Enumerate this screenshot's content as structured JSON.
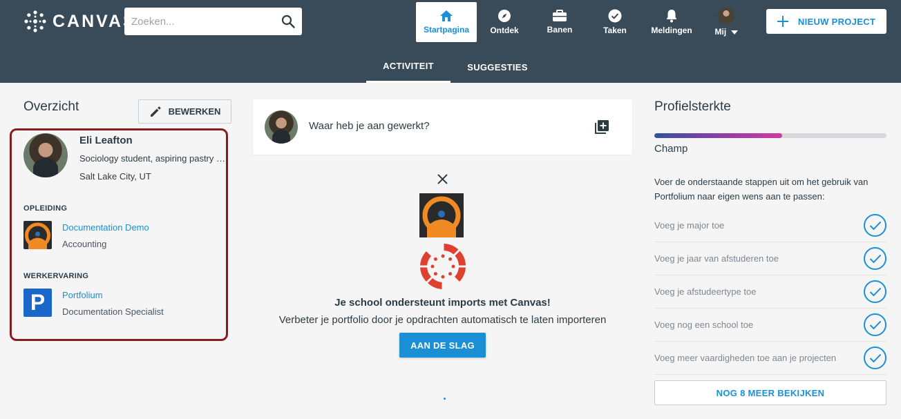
{
  "header": {
    "logo_text": "CANVAS",
    "search": {
      "placeholder": "Zoeken..."
    },
    "nav": [
      {
        "label": "Startpagina",
        "icon": "home-icon",
        "active": true
      },
      {
        "label": "Ontdek",
        "icon": "compass-icon"
      },
      {
        "label": "Banen",
        "icon": "briefcase-icon"
      },
      {
        "label": "Taken",
        "icon": "check-circle-icon"
      },
      {
        "label": "Meldingen",
        "icon": "bell-icon"
      },
      {
        "label": "Mij",
        "icon": "avatar"
      }
    ],
    "new_project_label": "NIEUW PROJECT",
    "tabs": [
      {
        "label": "ACTIVITEIT",
        "active": true
      },
      {
        "label": "SUGGESTIES"
      }
    ]
  },
  "overview": {
    "title": "Overzicht",
    "edit_label": "BEWERKEN",
    "profile": {
      "name": "Eli Leafton",
      "bio": "Sociology student, aspiring pastry chef",
      "location": "Salt Lake City, UT"
    },
    "education": {
      "heading": "OPLEIDING",
      "school": "Documentation Demo",
      "major": "Accounting"
    },
    "work": {
      "heading": "WERKERVARING",
      "company": "Portfolium",
      "role": "Documentation Specialist"
    }
  },
  "feed": {
    "prompt": "Waar heb je aan gewerkt?",
    "import_title": "Je school ondersteunt imports met Canvas!",
    "import_subtitle": "Verbeter je portfolio door je opdrachten automatisch te laten importeren",
    "start_label": "AAN DE SLAG"
  },
  "strength": {
    "title": "Profielsterkte",
    "progress": 0.55,
    "level": "Champ",
    "intro": "Voer de onderstaande stappen uit om het gebruik van Portfolium naar eigen wens aan te passen:",
    "steps": [
      {
        "label": "Voeg je major toe",
        "done": true
      },
      {
        "label": "Voeg je jaar van afstuderen toe",
        "done": true
      },
      {
        "label": "Voeg je afstudeertype toe",
        "done": true
      },
      {
        "label": "Voeg nog een school toe",
        "done": true
      },
      {
        "label": "Voeg meer vaardigheden toe aan je projecten",
        "done": true
      }
    ],
    "more_label": "NOG 8 MEER BEKIJKEN"
  },
  "colors": {
    "header_bg": "#394b58",
    "accent": "#1a8fd6",
    "highlight_border": "#8b1a1f",
    "canvas_red": "#e0402f",
    "portfolium_orange": "#f08a24"
  }
}
